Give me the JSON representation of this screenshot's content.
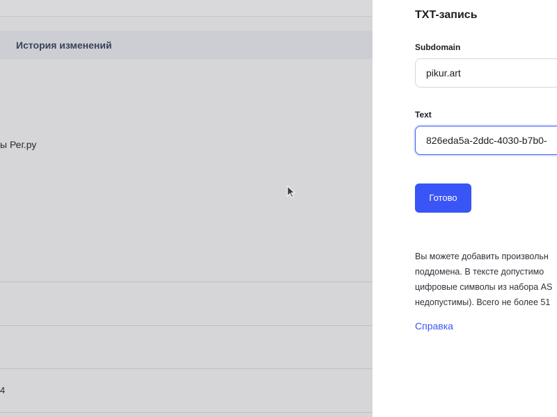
{
  "background": {
    "tab_label": "История изменений",
    "content_text": "ы Рег.ру",
    "row_text": "4"
  },
  "panel": {
    "title": "TXT-запись",
    "subdomain": {
      "label": "Subdomain",
      "value": "pikur.art"
    },
    "text": {
      "label": "Text",
      "value": "826eda5a-2ddc-4030-b7b0-"
    },
    "done_button": "Готово",
    "description_lines": [
      "Вы можете добавить произвольн",
      "поддомена. В тексте допустимо",
      "цифровые символы из набора AS",
      "недопустимы). Всего не более 51"
    ],
    "help_link": "Справка"
  },
  "colors": {
    "accent": "#3a55f5",
    "overlay_bg": "#d6d6d8",
    "panel_bg": "#ffffff"
  },
  "icons": {
    "cursor": "mouse-pointer-icon"
  }
}
